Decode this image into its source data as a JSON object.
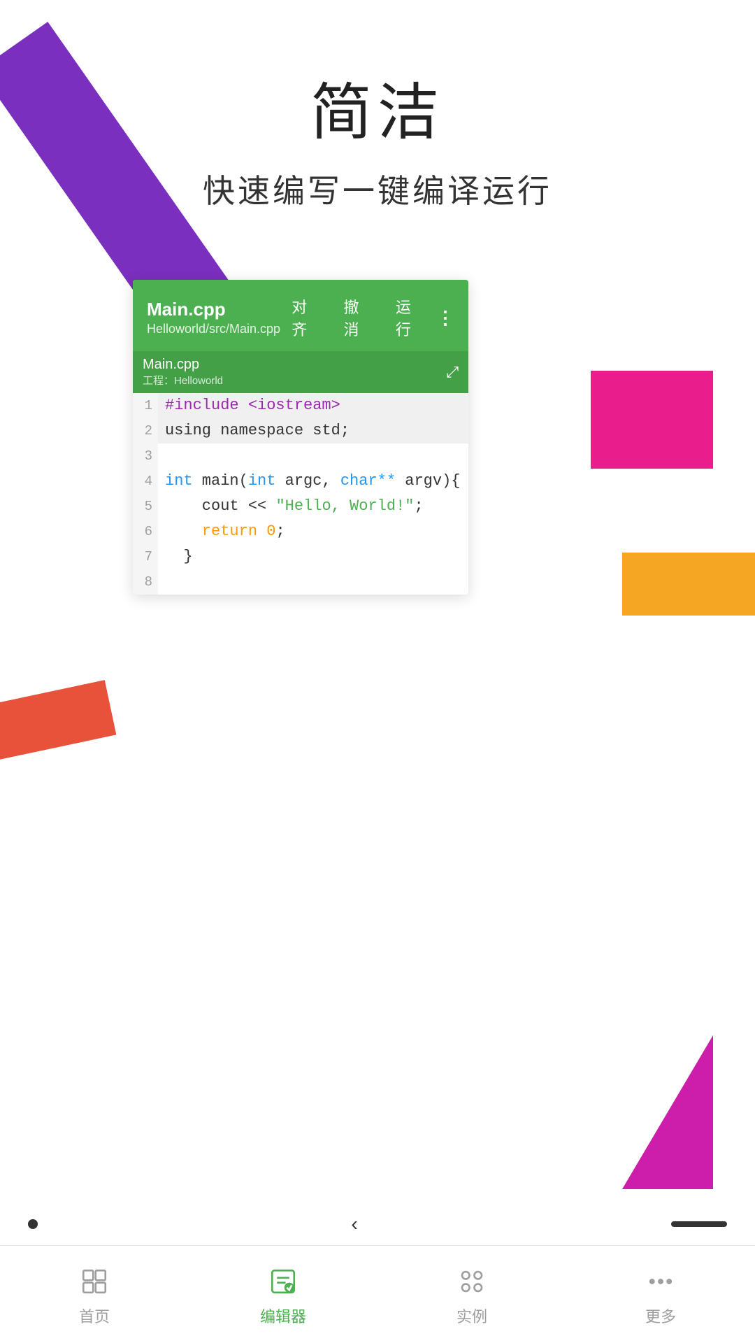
{
  "header": {
    "title": "简洁",
    "subtitle": "快速编写一键编译运行"
  },
  "editor": {
    "filename": "Main.cpp",
    "filepath": "Helloworld/src/Main.cpp",
    "actions": {
      "align": "对齐",
      "undo": "撤消",
      "run": "运行"
    },
    "tab": {
      "name": "Main.cpp",
      "project": "工程：Helloworld"
    },
    "code_lines": [
      {
        "num": "1",
        "content": "#include <iostream>"
      },
      {
        "num": "2",
        "content": "using namespace std;"
      },
      {
        "num": "3",
        "content": ""
      },
      {
        "num": "4",
        "content": "int main(int argc, char** argv){"
      },
      {
        "num": "5",
        "content": "    cout << \"Hello, World!\";"
      },
      {
        "num": "6",
        "content": "    return 0;"
      },
      {
        "num": "7",
        "content": "  }"
      },
      {
        "num": "8",
        "content": ""
      }
    ]
  },
  "bottom_nav": {
    "items": [
      {
        "id": "home",
        "label": "首页",
        "active": false
      },
      {
        "id": "editor",
        "label": "编辑器",
        "active": true
      },
      {
        "id": "examples",
        "label": "实例",
        "active": false
      },
      {
        "id": "more",
        "label": "更多",
        "active": false
      }
    ]
  }
}
